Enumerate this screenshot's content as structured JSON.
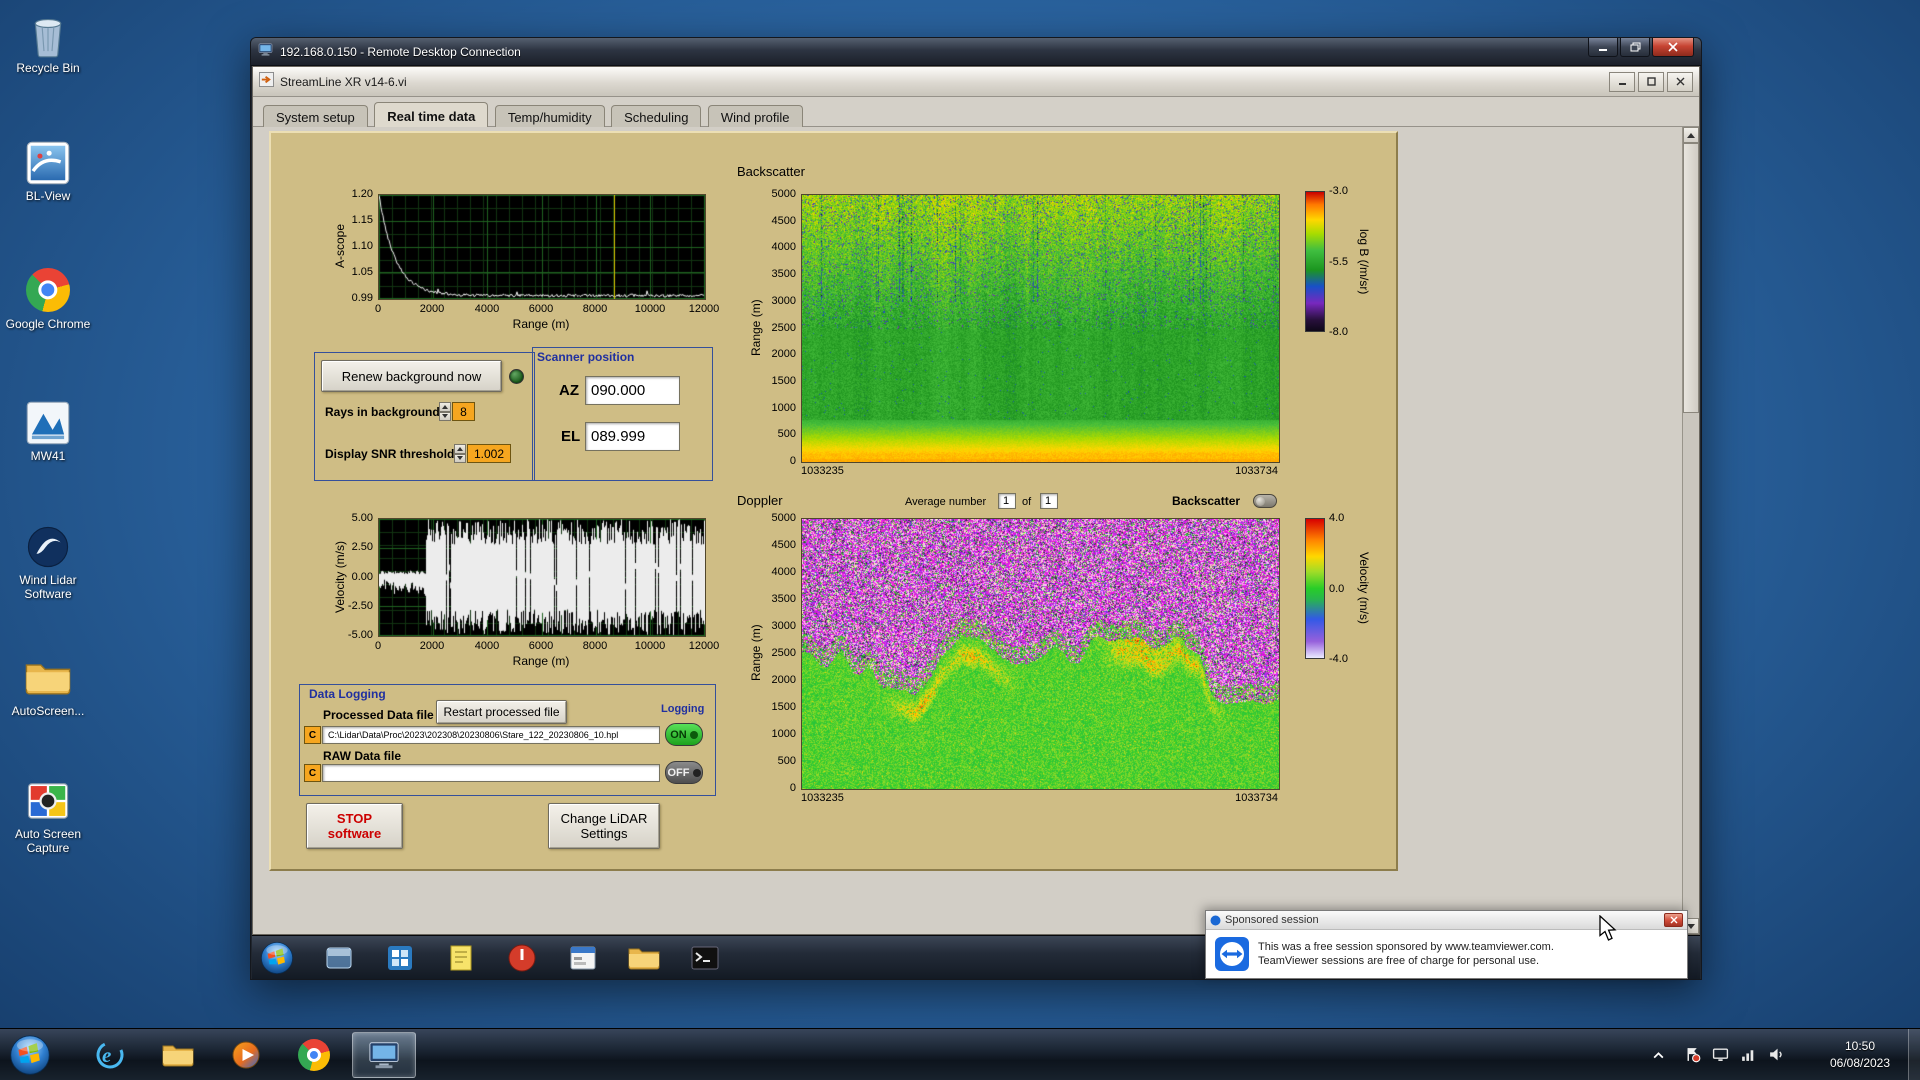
{
  "desktop": {
    "icons": [
      {
        "label": "Recycle Bin"
      },
      {
        "label": "BL-View"
      },
      {
        "label": "Google Chrome"
      },
      {
        "label": "MW41"
      },
      {
        "label": "Wind Lidar Software"
      },
      {
        "label": "AutoScreen..."
      },
      {
        "label": "Auto Screen Capture"
      }
    ]
  },
  "rdp": {
    "title": "192.168.0.150 - Remote Desktop Connection"
  },
  "app": {
    "title": "StreamLine XR v14-6.vi",
    "tabs": [
      "System setup",
      "Real time data",
      "Temp/humidity",
      "Scheduling",
      "Wind profile"
    ]
  },
  "ascope": {
    "y_label": "A-scope",
    "y_ticks": [
      "1.20",
      "1.15",
      "1.10",
      "1.05",
      "0.99"
    ],
    "x_ticks": [
      "0",
      "2000",
      "4000",
      "6000",
      "8000",
      "10000",
      "12000"
    ],
    "x_label": "Range (m)",
    "cursor_frac": 0.72
  },
  "velocity_plot": {
    "y_label": "Velocity (m/s)",
    "y_ticks": [
      "5.00",
      "2.50",
      "0.00",
      "-2.50",
      "-5.00"
    ],
    "x_ticks": [
      "0",
      "2000",
      "4000",
      "6000",
      "8000",
      "10000",
      "12000"
    ],
    "x_label": "Range (m)"
  },
  "controls": {
    "renew_button": "Renew background now",
    "rays_label": "Rays in background",
    "rays_value": "8",
    "snr_label": "Display SNR threshold",
    "snr_value": "1.002",
    "scanner_title": "Scanner position",
    "az_label": "AZ",
    "az_value": "090.000",
    "el_label": "EL",
    "el_value": "089.999"
  },
  "backscatter": {
    "title": "Backscatter",
    "y_label": "Range (m)",
    "y_ticks": [
      "5000",
      "4500",
      "4000",
      "3500",
      "3000",
      "2500",
      "2000",
      "1500",
      "1000",
      "500",
      "0"
    ],
    "x_start": "1033235",
    "x_end": "1033734",
    "colorbar_ticks": [
      "-3.0",
      "-5.5",
      "-8.0"
    ],
    "colorbar_label": "log B (/m/sr)"
  },
  "doppler": {
    "title": "Doppler",
    "avg_label": "Average number",
    "avg_value": "1",
    "of_label": "of",
    "of_count": "1",
    "toggle_label": "Backscatter",
    "y_label": "Range (m)",
    "y_ticks": [
      "5000",
      "4500",
      "4000",
      "3500",
      "3000",
      "2500",
      "2000",
      "1500",
      "1000",
      "500",
      "0"
    ],
    "x_start": "1033235",
    "x_end": "1033734",
    "colorbar_ticks": [
      "4.0",
      "0.0",
      "-4.0"
    ],
    "colorbar_label": "Velocity (m/s)"
  },
  "logging": {
    "box_title": "Data Logging",
    "processed_label": "Processed Data file",
    "restart_button": "Restart processed file",
    "logging_label": "Logging",
    "drive_label": "C",
    "processed_path": "C:\\Lidar\\Data\\Proc\\2023\\202308\\20230806\\Stare_122_20230806_10.hpl",
    "on_label": "ON",
    "raw_label": "RAW Data file",
    "raw_path": "",
    "off_label": "OFF"
  },
  "footer_buttons": {
    "stop_line1": "STOP",
    "stop_line2": "software",
    "change_line1": "Change LiDAR",
    "change_line2": "Settings"
  },
  "popup": {
    "title": "Sponsored session",
    "line1": "This was a free session sponsored by www.teamviewer.com.",
    "line2": "TeamViewer sessions are free of charge for personal use."
  },
  "system_tray": {
    "time": "10:50",
    "date": "06/08/2023"
  }
}
